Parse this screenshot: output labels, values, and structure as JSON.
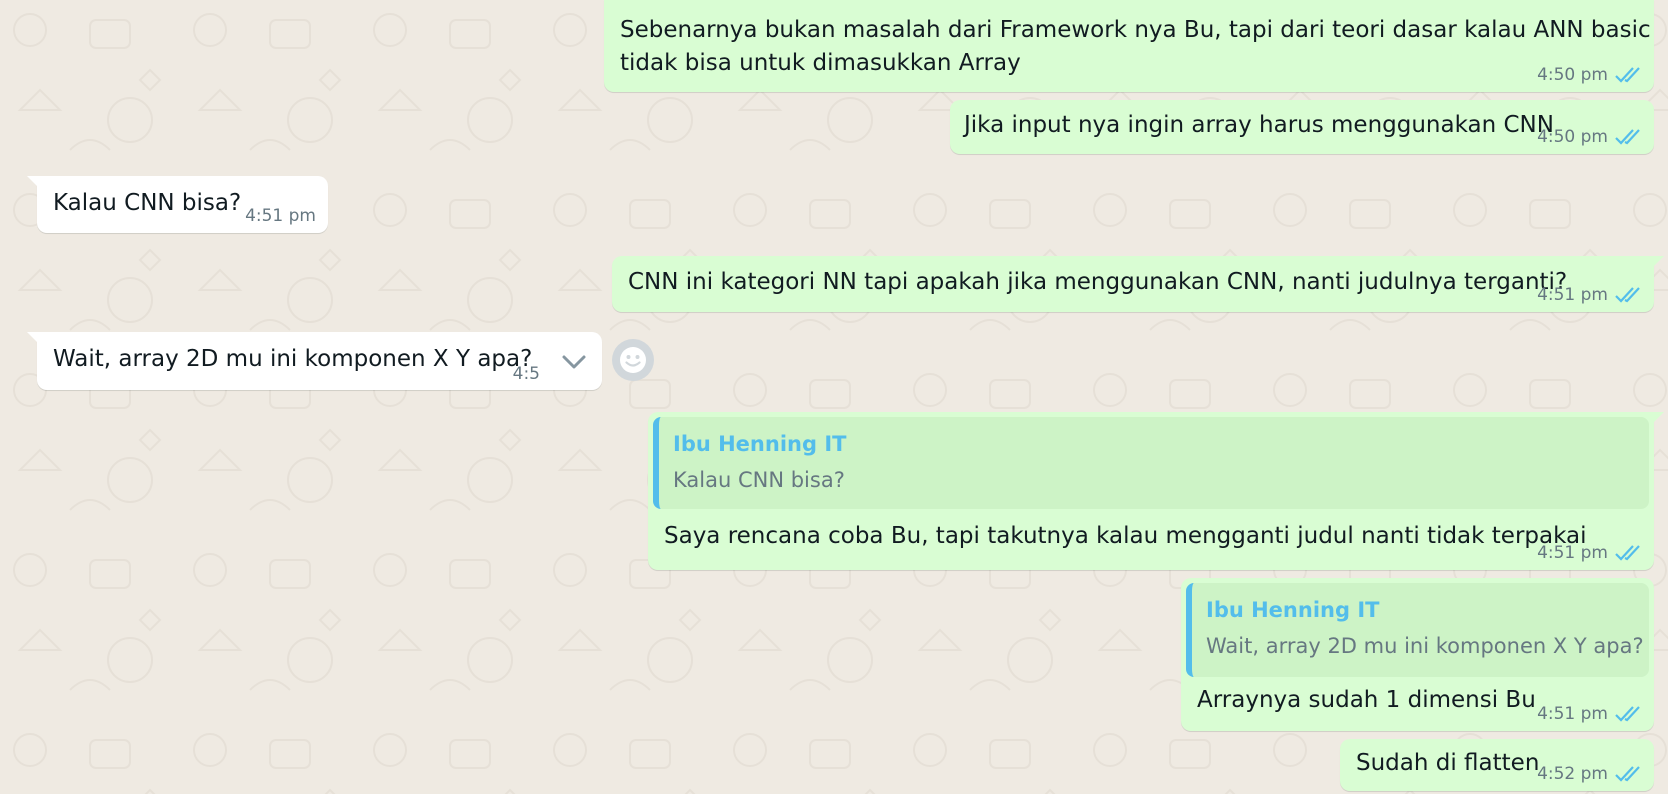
{
  "messages": [
    {
      "id": "m1",
      "dir": "out",
      "text": "Sebenarnya bukan masalah dari Framework nya Bu, tapi dari teori dasar kalau ANN basic\ntidak bisa untuk dimasukkan Array",
      "time": "4:50 pm",
      "status": "read"
    },
    {
      "id": "m2",
      "dir": "out",
      "text": "Jika input nya ingin array harus menggunakan CNN",
      "time": "4:50 pm",
      "status": "read"
    },
    {
      "id": "m3",
      "dir": "in",
      "text": "Kalau CNN bisa?",
      "time": "4:51 pm"
    },
    {
      "id": "m4",
      "dir": "out",
      "text": "CNN ini kategori NN tapi apakah jika menggunakan CNN, nanti judulnya terganti?",
      "time": "4:51 pm",
      "status": "read"
    },
    {
      "id": "m5",
      "dir": "in",
      "text": "Wait, array 2D mu ini komponen X Y apa?",
      "time": "4:5",
      "hovered": true
    },
    {
      "id": "m6",
      "dir": "out",
      "quote": {
        "author": "Ibu Henning IT",
        "text": "Kalau CNN bisa?"
      },
      "text": "Saya rencana coba Bu, tapi takutnya kalau mengganti judul nanti tidak terpakai",
      "time": "4:51 pm",
      "status": "read"
    },
    {
      "id": "m7",
      "dir": "out",
      "quote": {
        "author": "Ibu Henning IT",
        "text": "Wait, array 2D mu ini komponen X Y apa?"
      },
      "text": "Arraynya sudah 1 dimensi Bu",
      "time": "4:51 pm",
      "status": "read"
    },
    {
      "id": "m8",
      "dir": "out",
      "text": "Sudah di flatten",
      "time": "4:52 pm",
      "status": "read"
    }
  ],
  "colors": {
    "outgoing": "#d9fdd3",
    "incoming": "#ffffff",
    "background": "#efeae2",
    "tick": "#53bdeb",
    "quote_author": "#53bdeb"
  },
  "icons": {
    "read_receipt": "double-check-icon",
    "menu": "chevron-down-icon",
    "react": "emoji-icon"
  }
}
